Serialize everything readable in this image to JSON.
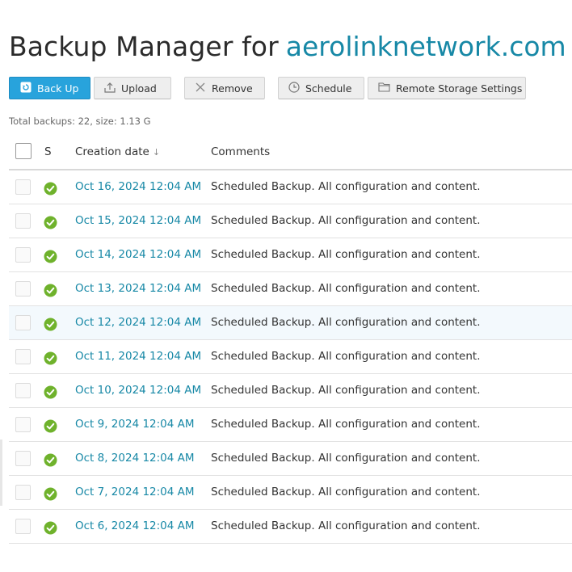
{
  "header": {
    "title": "Backup Manager for",
    "domain": "aerolinknetwork.com",
    "domain_caret": "⌄"
  },
  "toolbar": {
    "backup_label": "Back Up",
    "upload_label": "Upload",
    "remove_label": "Remove",
    "schedule_label": "Schedule",
    "remote_label": "Remote Storage Settings"
  },
  "summary": "Total backups: 22, size: 1.13 G",
  "table": {
    "columns": {
      "status": "S",
      "date": "Creation date",
      "date_sort": "↓",
      "comments": "Comments"
    },
    "rows": [
      {
        "date": "Oct 16, 2024 12:04 AM",
        "comment": "Scheduled Backup. All configuration and content.",
        "status": "ok"
      },
      {
        "date": "Oct 15, 2024 12:04 AM",
        "comment": "Scheduled Backup. All configuration and content.",
        "status": "ok"
      },
      {
        "date": "Oct 14, 2024 12:04 AM",
        "comment": "Scheduled Backup. All configuration and content.",
        "status": "ok"
      },
      {
        "date": "Oct 13, 2024 12:04 AM",
        "comment": "Scheduled Backup. All configuration and content.",
        "status": "ok"
      },
      {
        "date": "Oct 12, 2024 12:04 AM",
        "comment": "Scheduled Backup. All configuration and content.",
        "status": "ok"
      },
      {
        "date": "Oct 11, 2024 12:04 AM",
        "comment": "Scheduled Backup. All configuration and content.",
        "status": "ok"
      },
      {
        "date": "Oct 10, 2024 12:04 AM",
        "comment": "Scheduled Backup. All configuration and content.",
        "status": "ok"
      },
      {
        "date": "Oct 9, 2024 12:04 AM",
        "comment": "Scheduled Backup. All configuration and content.",
        "status": "ok"
      },
      {
        "date": "Oct 8, 2024 12:04 AM",
        "comment": "Scheduled Backup. All configuration and content.",
        "status": "ok"
      },
      {
        "date": "Oct 7, 2024 12:04 AM",
        "comment": "Scheduled Backup. All configuration and content.",
        "status": "ok"
      },
      {
        "date": "Oct 6, 2024 12:04 AM",
        "comment": "Scheduled Backup. All configuration and content.",
        "status": "ok"
      }
    ]
  },
  "icons": {
    "status_ok": "check-circle-icon",
    "backup": "backup-icon",
    "upload": "upload-icon",
    "remove": "remove-icon",
    "schedule": "clock-icon",
    "remote": "folder-icon"
  },
  "colors": {
    "accent": "#1788a6",
    "primary_button": "#28a3dc",
    "status_ok": "#6fb22c",
    "row_highlight": "#f3f9fd"
  }
}
